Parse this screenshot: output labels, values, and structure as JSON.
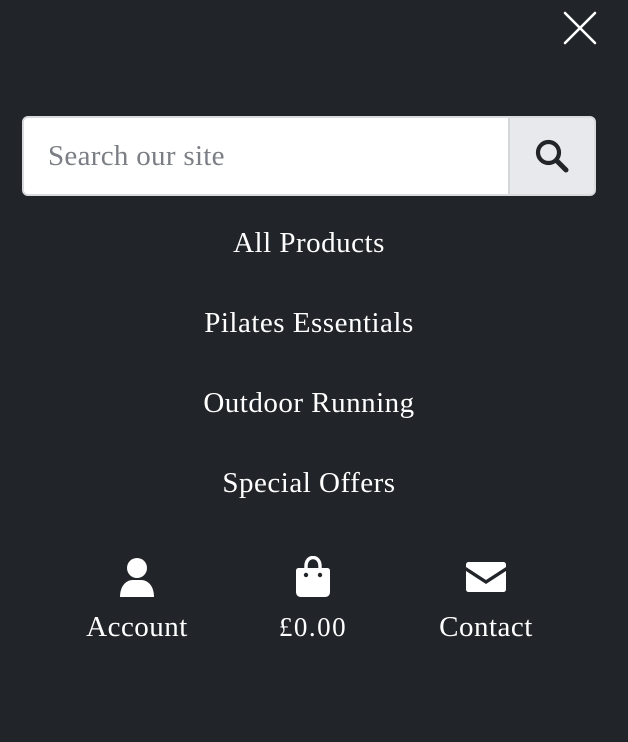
{
  "search": {
    "placeholder": "Search our site",
    "value": ""
  },
  "nav": {
    "items": [
      {
        "label": "All Products"
      },
      {
        "label": "Pilates Essentials"
      },
      {
        "label": "Outdoor Running"
      },
      {
        "label": "Special Offers"
      }
    ]
  },
  "footer": {
    "account_label": "Account",
    "cart_total": "£0.00",
    "contact_label": "Contact"
  },
  "icons": {
    "close": "close-icon",
    "search": "search-icon",
    "account": "user-icon",
    "cart": "shopping-bag-icon",
    "contact": "envelope-icon"
  },
  "colors": {
    "background": "#212428",
    "text": "#ffffff",
    "input_background": "#ffffff",
    "search_button_background": "#e8e9ec",
    "placeholder": "#7b7f85"
  }
}
